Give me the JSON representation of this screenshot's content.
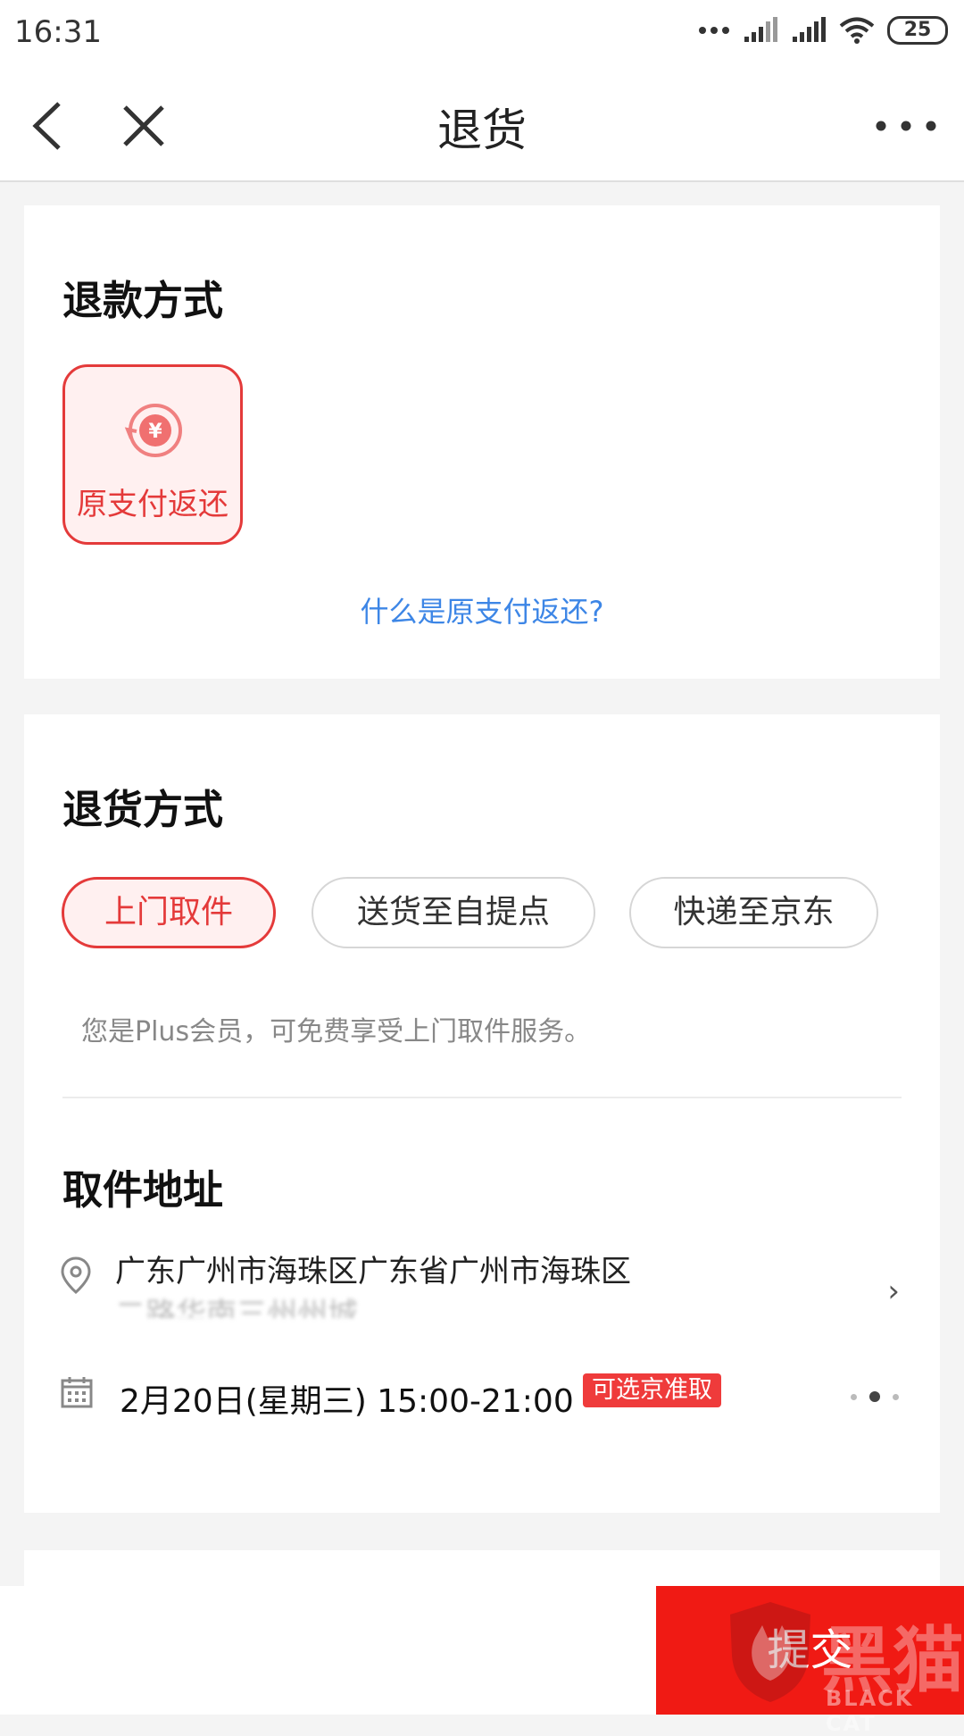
{
  "status": {
    "time": "16:31",
    "battery": "25"
  },
  "nav": {
    "title": "退货"
  },
  "refund": {
    "heading": "退款方式",
    "option_label": "原支付返还",
    "option_icon": "yuan-refund-icon",
    "help_link": "什么是原支付返还?"
  },
  "return_method": {
    "heading": "退货方式",
    "options": [
      {
        "label": "上门取件",
        "selected": true
      },
      {
        "label": "送货至自提点",
        "selected": false
      },
      {
        "label": "快递至京东",
        "selected": false
      }
    ],
    "note": "您是Plus会员，可免费享受上门取件服务。"
  },
  "pickup": {
    "heading": "取件地址",
    "address": "广东广州市海珠区广东省广州市海珠区",
    "address_blurred": "二路华南三州州城",
    "time": "2月20日(星期三) 15:00-21:00",
    "badge": "可选京准取"
  },
  "footer": {
    "submit": "提交"
  },
  "watermark": {
    "text": "黑猫",
    "sub": "BLACK CAT"
  },
  "colors": {
    "accent": "#e43a3a",
    "link": "#3d86e6",
    "submit": "#f01a14"
  }
}
